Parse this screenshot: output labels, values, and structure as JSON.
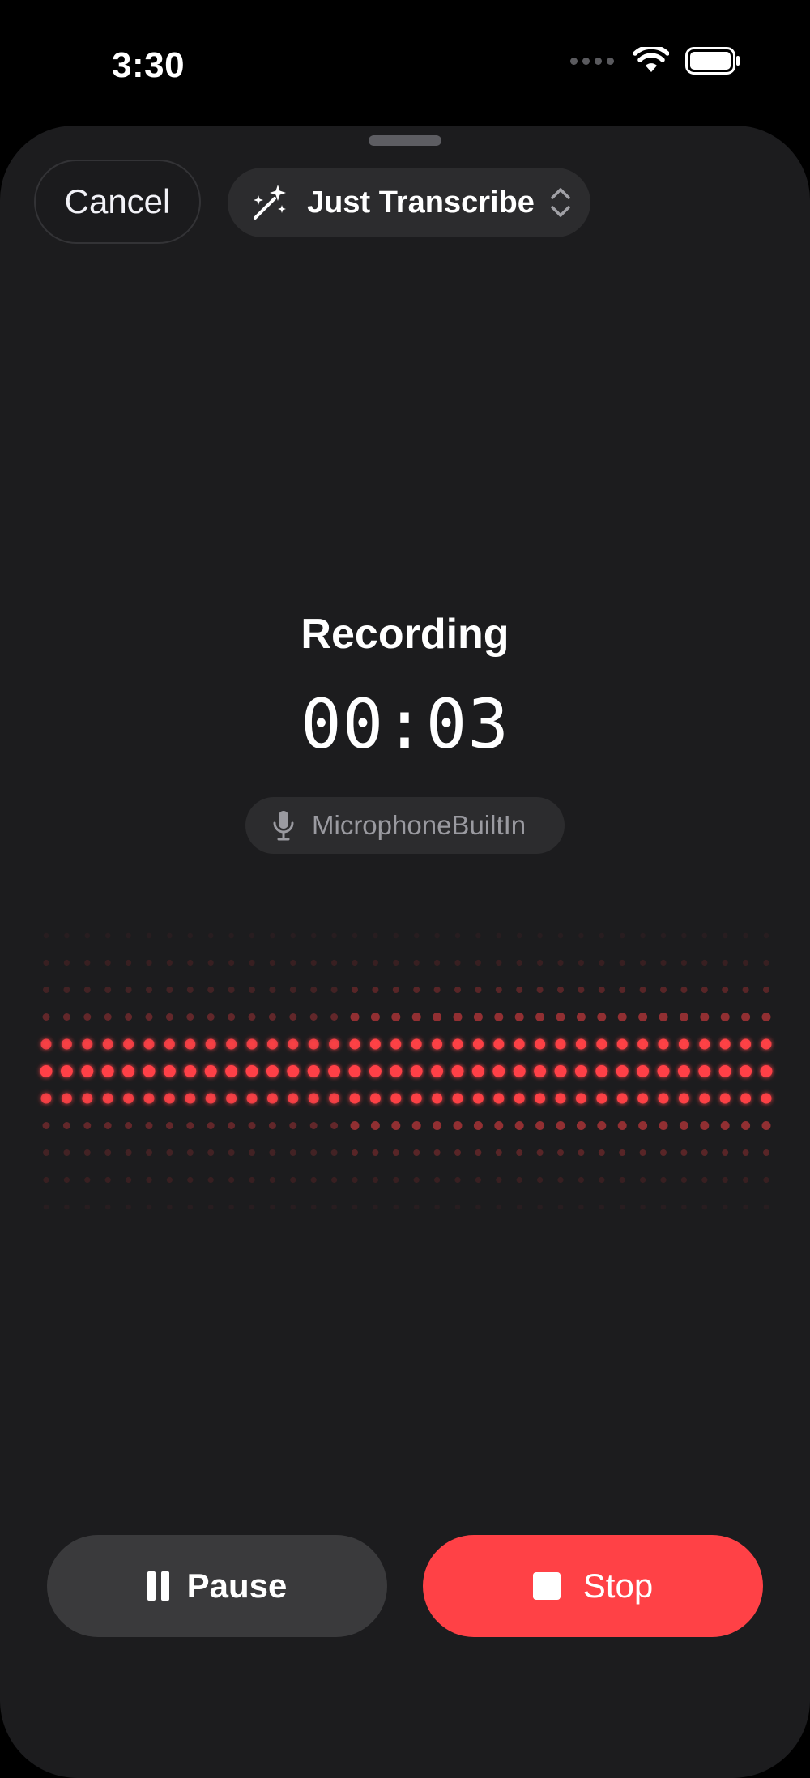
{
  "status": {
    "time": "3:30"
  },
  "toolbar": {
    "cancel_label": "Cancel",
    "mode_label": "Just Transcribe"
  },
  "recording": {
    "title": "Recording",
    "elapsed": "00:03",
    "input_device": "MicrophoneBuiltIn"
  },
  "controls": {
    "pause_label": "Pause",
    "stop_label": "Stop"
  },
  "icons": {
    "mode": "magic-wand-icon",
    "mode_chevron": "chevron-up-down-icon",
    "mic": "microphone-icon",
    "pause": "pause-icon",
    "stop": "stop-icon",
    "wifi": "wifi-icon",
    "battery": "battery-icon",
    "signal": "cellular-signal-icon"
  },
  "colors": {
    "accent": "#ff4146",
    "sheet_background": "#1c1c1e",
    "pill_background": "#2c2c2e",
    "pause_background": "#3a3a3c"
  }
}
